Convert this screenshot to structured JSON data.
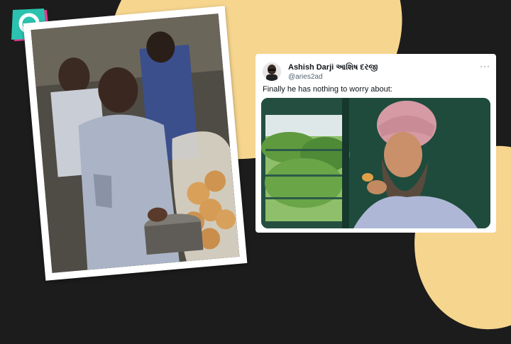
{
  "brand": {
    "logo_icon": "the-quint-logo-icon",
    "color_teal": "#2bc3b0",
    "color_pink": "#e23a8f"
  },
  "colors": {
    "background": "#1c1c1c",
    "accent_blob": "#f6d58e"
  },
  "left_photo": {
    "subject": "vendor-serving-pani-puri-on-train"
  },
  "tweet": {
    "display_name": "Ashish Darji આશિષ દરજી",
    "handle": "@aries2ad",
    "text": "Finally he has nothing to worry about:",
    "more_icon": "more-horizontal-icon",
    "media_subject": "man-in-turban-eating-pani-puri-at-train-window"
  }
}
